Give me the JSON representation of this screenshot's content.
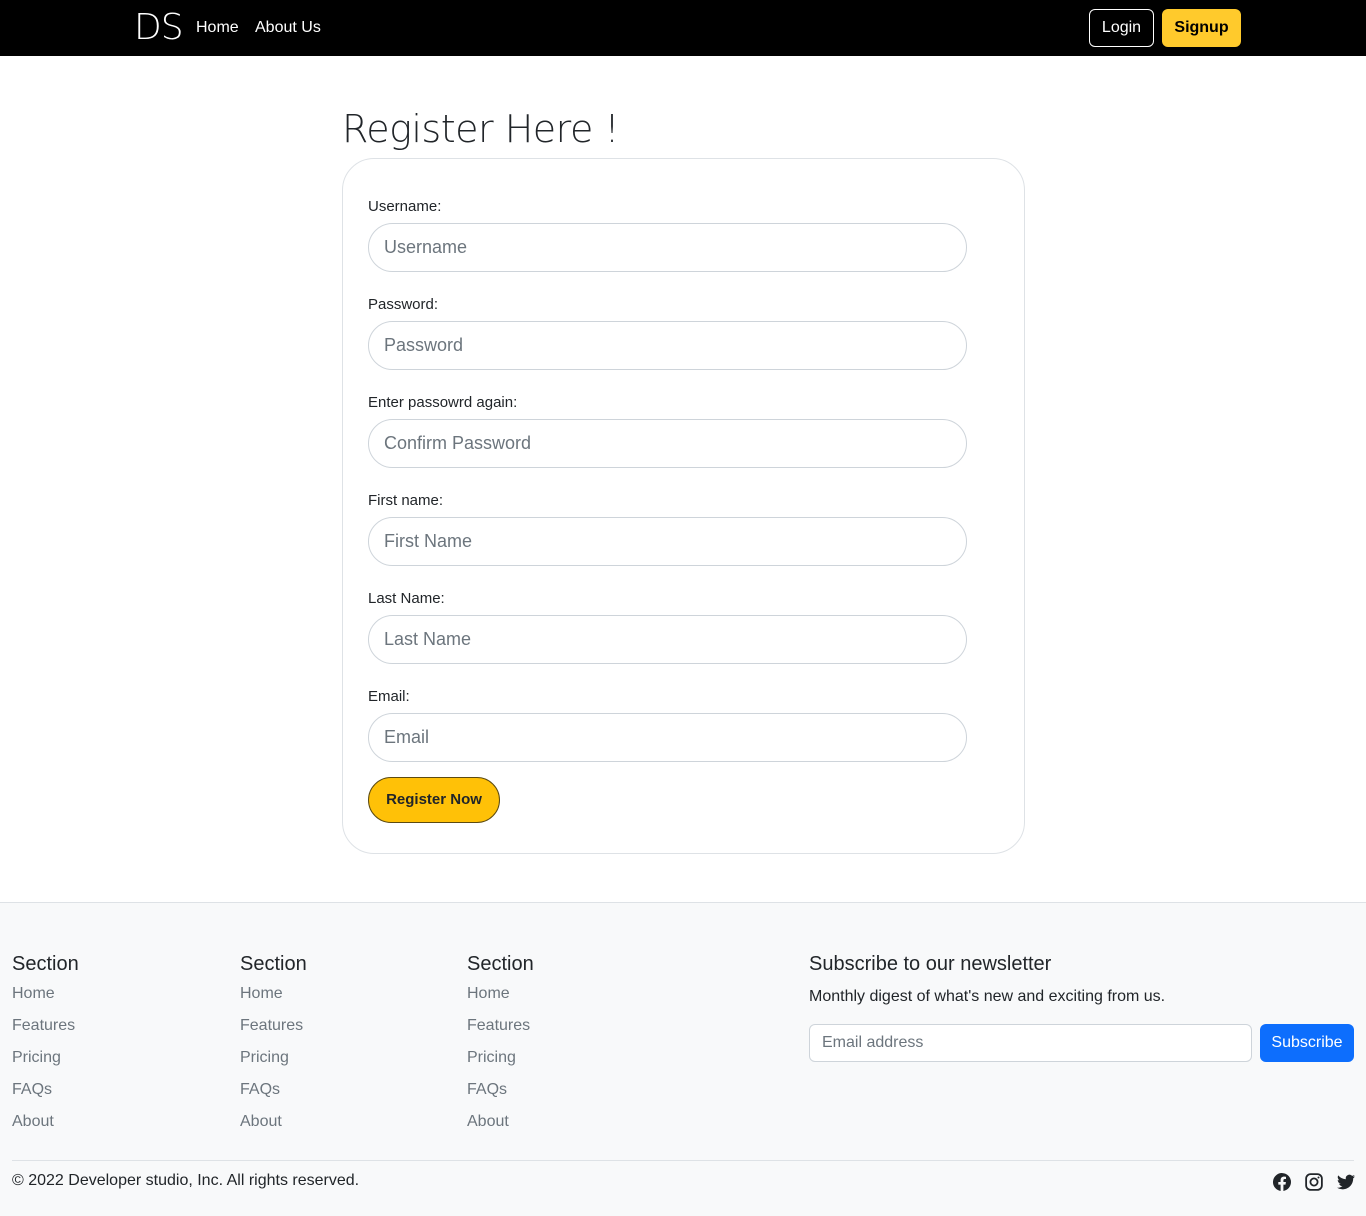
{
  "navbar": {
    "brand": "DS",
    "links": [
      "Home",
      "About Us"
    ],
    "login_label": "Login",
    "signup_label": "Signup"
  },
  "form": {
    "title": "Register Here !",
    "fields": [
      {
        "label": "Username:",
        "placeholder": "Username"
      },
      {
        "label": "Password:",
        "placeholder": "Password"
      },
      {
        "label": "Enter passowrd again:",
        "placeholder": "Confirm Password"
      },
      {
        "label": "First name:",
        "placeholder": "First Name"
      },
      {
        "label": "Last Name:",
        "placeholder": "Last Name"
      },
      {
        "label": "Email:",
        "placeholder": "Email"
      }
    ],
    "submit_label": "Register Now"
  },
  "footer": {
    "sections": [
      {
        "heading": "Section",
        "links": [
          "Home",
          "Features",
          "Pricing",
          "FAQs",
          "About"
        ]
      },
      {
        "heading": "Section",
        "links": [
          "Home",
          "Features",
          "Pricing",
          "FAQs",
          "About"
        ]
      },
      {
        "heading": "Section",
        "links": [
          "Home",
          "Features",
          "Pricing",
          "FAQs",
          "About"
        ]
      }
    ],
    "newsletter": {
      "heading": "Subscribe to our newsletter",
      "description": "Monthly digest of what's new and exciting from us.",
      "placeholder": "Email address",
      "button_label": "Subscribe"
    },
    "copyright": "© 2022 Developer studio, Inc. All rights reserved.",
    "social_icons": [
      "facebook-icon",
      "instagram-icon",
      "twitter-icon"
    ]
  },
  "colors": {
    "navbar_bg": "#000000",
    "accent_yellow": "#ffc107",
    "primary_blue": "#0d6efd",
    "footer_bg": "#f8f9fa"
  }
}
